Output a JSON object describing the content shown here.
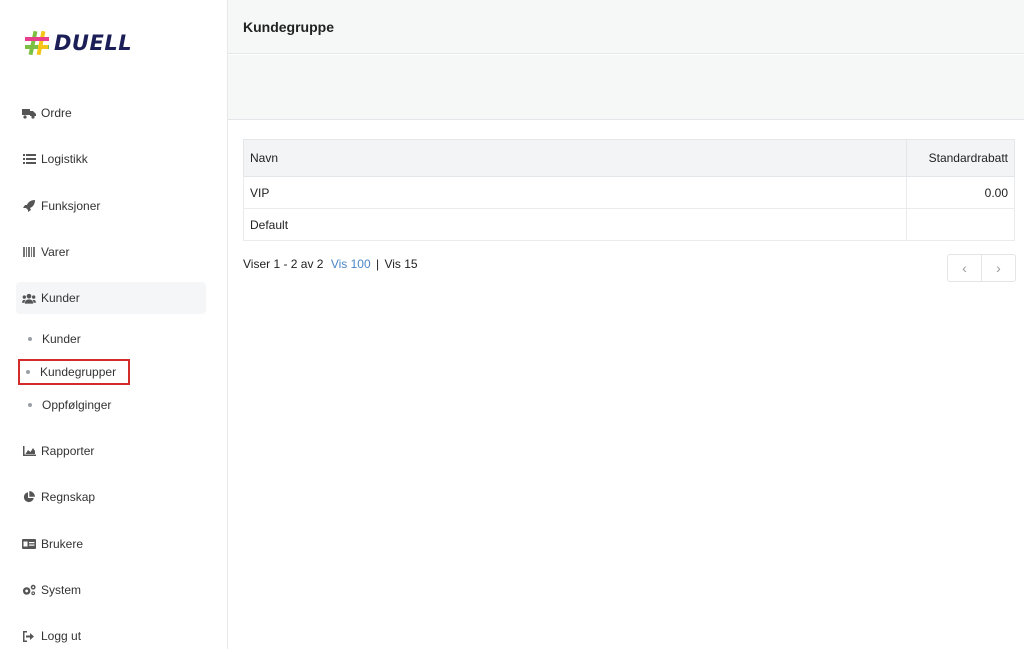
{
  "brand": {
    "name": "DUELL",
    "colors": {
      "green": "#7bc043",
      "pink": "#e83e8c",
      "yellow": "#f5c518",
      "navy": "#1c1f57"
    }
  },
  "sidebar": {
    "items": [
      {
        "label": "Ordre",
        "icon": "truck-icon"
      },
      {
        "label": "Logistikk",
        "icon": "list-icon"
      },
      {
        "label": "Funksjoner",
        "icon": "rocket-icon"
      },
      {
        "label": "Varer",
        "icon": "barcode-icon"
      },
      {
        "label": "Kunder",
        "icon": "users-icon"
      },
      {
        "label": "Rapporter",
        "icon": "area-chart-icon"
      },
      {
        "label": "Regnskap",
        "icon": "pie-chart-icon"
      },
      {
        "label": "Brukere",
        "icon": "id-card-icon"
      },
      {
        "label": "System",
        "icon": "cogs-icon"
      },
      {
        "label": "Logg ut",
        "icon": "sign-out-icon"
      }
    ],
    "sub_items": [
      {
        "label": "Kunder"
      },
      {
        "label": "Kundegrupper",
        "selected": true
      },
      {
        "label": "Oppfølginger"
      }
    ]
  },
  "header": {
    "title": "Kundegruppe"
  },
  "table": {
    "columns": [
      "Navn",
      "Standardrabatt"
    ],
    "rows": [
      [
        "VIP",
        "0.00"
      ],
      [
        "Default",
        ""
      ]
    ]
  },
  "pagination": {
    "summary": "Viser 1 - 2 av 2",
    "show_100": "Vis 100",
    "separator": "|",
    "show_15": "Vis 15",
    "prev": "‹",
    "next": "›"
  }
}
